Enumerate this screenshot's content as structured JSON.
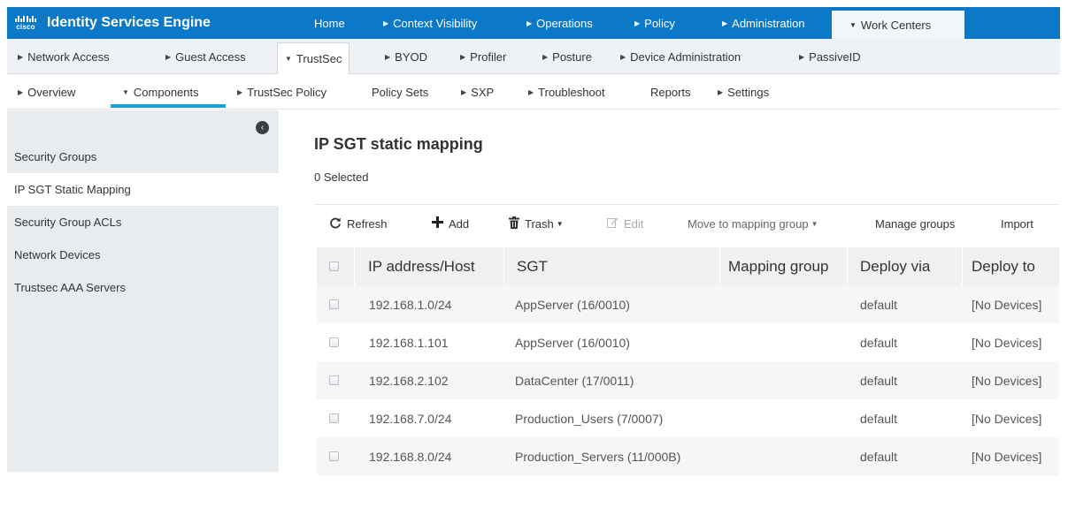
{
  "header": {
    "logo_text": "cisco",
    "product_title": "Identity Services Engine",
    "nav": [
      {
        "label": "Home",
        "arrow": ""
      },
      {
        "label": "Context Visibility",
        "arrow": "▶"
      },
      {
        "label": "Operations",
        "arrow": "▶"
      },
      {
        "label": "Policy",
        "arrow": "▶"
      },
      {
        "label": "Administration",
        "arrow": "▶"
      },
      {
        "label": "Work Centers",
        "arrow": "▼"
      }
    ]
  },
  "subnav": [
    {
      "label": "Network Access",
      "arrow": "▶"
    },
    {
      "label": "Guest Access",
      "arrow": "▶"
    },
    {
      "label": "TrustSec",
      "arrow": "▼"
    },
    {
      "label": "BYOD",
      "arrow": "▶"
    },
    {
      "label": "Profiler",
      "arrow": "▶"
    },
    {
      "label": "Posture",
      "arrow": "▶"
    },
    {
      "label": "Device Administration",
      "arrow": "▶"
    },
    {
      "label": "PassiveID",
      "arrow": "▶"
    }
  ],
  "tabnav": [
    {
      "label": "Overview",
      "arrow": "▶"
    },
    {
      "label": "Components",
      "arrow": "▼"
    },
    {
      "label": "TrustSec Policy",
      "arrow": "▶"
    },
    {
      "label": "Policy Sets",
      "arrow": ""
    },
    {
      "label": "SXP",
      "arrow": "▶"
    },
    {
      "label": "Troubleshoot",
      "arrow": "▶"
    },
    {
      "label": "Reports",
      "arrow": ""
    },
    {
      "label": "Settings",
      "arrow": "▶"
    }
  ],
  "sidebar": {
    "collapse_glyph": "‹",
    "items": [
      {
        "label": "Security Groups"
      },
      {
        "label": "IP SGT Static Mapping"
      },
      {
        "label": "Security Group ACLs"
      },
      {
        "label": "Network Devices"
      },
      {
        "label": "Trustsec AAA Servers"
      }
    ]
  },
  "main": {
    "title": "IP SGT static mapping",
    "selected": "0 Selected",
    "toolbar": {
      "refresh": "Refresh",
      "add": "Add",
      "trash": "Trash",
      "edit": "Edit",
      "move": "Move to mapping group",
      "manage": "Manage groups",
      "import": "Import"
    },
    "table": {
      "columns": [
        "IP address/Host",
        "SGT",
        "Mapping group",
        "Deploy via",
        "Deploy to"
      ],
      "rows": [
        {
          "ip": "192.168.1.0/24",
          "sgt": "AppServer (16/0010)",
          "group": "",
          "via": "default",
          "to": "[No Devices]"
        },
        {
          "ip": "192.168.1.101",
          "sgt": "AppServer (16/0010)",
          "group": "",
          "via": "default",
          "to": "[No Devices]"
        },
        {
          "ip": "192.168.2.102",
          "sgt": "DataCenter (17/0011)",
          "group": "",
          "via": "default",
          "to": "[No Devices]"
        },
        {
          "ip": "192.168.7.0/24",
          "sgt": "Production_Users (7/0007)",
          "group": "",
          "via": "default",
          "to": "[No Devices]"
        },
        {
          "ip": "192.168.8.0/24",
          "sgt": "Production_Servers (11/000B)",
          "group": "",
          "via": "default",
          "to": "[No Devices]"
        }
      ]
    }
  },
  "colors": {
    "header_bg": "#0b79c7",
    "active_tab_underline": "#17a3d8",
    "sidebar_bg": "#e8ecef"
  }
}
